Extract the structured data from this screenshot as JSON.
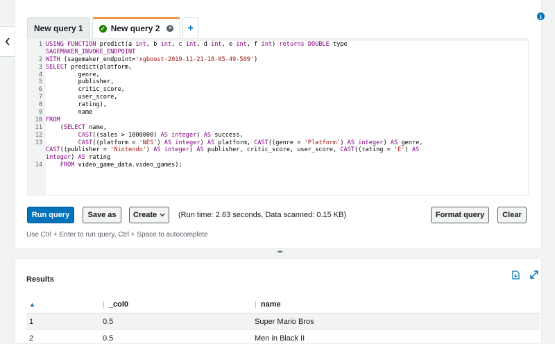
{
  "tabs": [
    {
      "label": "New query 1",
      "active": false
    },
    {
      "label": "New query 2",
      "active": true
    }
  ],
  "add_tab_label": "+",
  "editor": {
    "lines": [
      {
        "n": "1",
        "segs": [
          [
            "kw",
            "USING FUNCTION "
          ],
          [
            "",
            "predict(a "
          ],
          [
            "kw",
            "int"
          ],
          [
            "",
            ", b "
          ],
          [
            "kw",
            "int"
          ],
          [
            "",
            ", c "
          ],
          [
            "kw",
            "int"
          ],
          [
            "",
            ", d "
          ],
          [
            "kw",
            "int"
          ],
          [
            "",
            ", e "
          ],
          [
            "kw",
            "int"
          ],
          [
            "",
            ", f "
          ],
          [
            "kw",
            "int"
          ],
          [
            "",
            ") "
          ],
          [
            "kw",
            "returns DOUBLE "
          ],
          [
            "",
            "type"
          ]
        ]
      },
      {
        "n": "",
        "segs": [
          [
            "kw",
            "SAGEMAKER_INVOKE_ENDPOINT"
          ]
        ]
      },
      {
        "n": "2",
        "segs": [
          [
            "kw",
            "WITH "
          ],
          [
            "",
            "(sagemaker_endpoint="
          ],
          [
            "str",
            "'xgboost-2019-11-21-18-05-49-509'"
          ],
          [
            "",
            ")"
          ]
        ]
      },
      {
        "n": "3",
        "segs": [
          [
            "kw",
            "SELECT "
          ],
          [
            "",
            "predict(platform,"
          ]
        ]
      },
      {
        "n": "4",
        "segs": [
          [
            "",
            "         genre,"
          ]
        ]
      },
      {
        "n": "5",
        "segs": [
          [
            "",
            "         publisher,"
          ]
        ]
      },
      {
        "n": "6",
        "segs": [
          [
            "",
            "         critic_score,"
          ]
        ]
      },
      {
        "n": "7",
        "segs": [
          [
            "",
            "         user_score,"
          ]
        ]
      },
      {
        "n": "8",
        "segs": [
          [
            "",
            "         rating),"
          ]
        ]
      },
      {
        "n": "9",
        "segs": [
          [
            "",
            "         name"
          ]
        ]
      },
      {
        "n": "10",
        "segs": [
          [
            "kw",
            "FROM"
          ]
        ]
      },
      {
        "n": "11",
        "segs": [
          [
            "",
            "    ("
          ],
          [
            "kw",
            "SELECT "
          ],
          [
            "",
            "name,"
          ]
        ]
      },
      {
        "n": "12",
        "segs": [
          [
            "",
            "         "
          ],
          [
            "kw",
            "CAST"
          ],
          [
            "",
            "((sales > 1000000) "
          ],
          [
            "kw",
            "AS integer"
          ],
          [
            "",
            ") "
          ],
          [
            "kw",
            "AS "
          ],
          [
            "",
            "success,"
          ]
        ]
      },
      {
        "n": "13",
        "segs": [
          [
            "",
            "         "
          ],
          [
            "kw",
            "CAST"
          ],
          [
            "",
            "((platform = "
          ],
          [
            "str",
            "'NES'"
          ],
          [
            "",
            ") "
          ],
          [
            "kw",
            "AS integer"
          ],
          [
            "",
            ") "
          ],
          [
            "kw",
            "AS "
          ],
          [
            "",
            "platform, "
          ],
          [
            "kw",
            "CAST"
          ],
          [
            "",
            "((genre = "
          ],
          [
            "str",
            "'Platform'"
          ],
          [
            "",
            ") "
          ],
          [
            "kw",
            "AS integer"
          ],
          [
            "",
            ") "
          ],
          [
            "kw",
            "AS "
          ],
          [
            "",
            "genre,"
          ]
        ]
      },
      {
        "n": "",
        "segs": [
          [
            "kw",
            "CAST"
          ],
          [
            "",
            "((publisher = "
          ],
          [
            "str",
            "'Nintendo'"
          ],
          [
            "",
            ") "
          ],
          [
            "kw",
            "AS integer"
          ],
          [
            "",
            ") "
          ],
          [
            "kw",
            "AS "
          ],
          [
            "",
            "publisher, critic_score, user_score, "
          ],
          [
            "kw",
            "CAST"
          ],
          [
            "",
            "((rating = "
          ],
          [
            "str",
            "'E'"
          ],
          [
            "",
            ") "
          ],
          [
            "kw",
            "AS"
          ]
        ]
      },
      {
        "n": "",
        "segs": [
          [
            "kw",
            "integer"
          ],
          [
            "",
            ") "
          ],
          [
            "kw",
            "AS "
          ],
          [
            "",
            "rating"
          ]
        ]
      },
      {
        "n": "14",
        "segs": [
          [
            "",
            "    "
          ],
          [
            "kw",
            "FROM "
          ],
          [
            "",
            "video_game_data.video_games);"
          ]
        ]
      }
    ]
  },
  "toolbar": {
    "run_label": "Run query",
    "save_label": "Save as",
    "create_label": "Create",
    "run_info": "(Run time: 2.63 seconds, Data scanned: 0.15 KB)",
    "format_label": "Format query",
    "clear_label": "Clear"
  },
  "hint": "Use Ctrl + Enter to run query, Ctrl + Space to autocomplete",
  "results": {
    "title": "Results",
    "columns": [
      "_col0",
      "name"
    ],
    "rows": [
      {
        "idx": "1",
        "col0": "0.5",
        "name": "Super Mario Bros"
      },
      {
        "idx": "2",
        "col0": "0.5",
        "name": "Men in Black II"
      }
    ]
  },
  "colors": {
    "accent": "#0073bb",
    "tab_active": "#ec7211",
    "success": "#1d8102"
  }
}
